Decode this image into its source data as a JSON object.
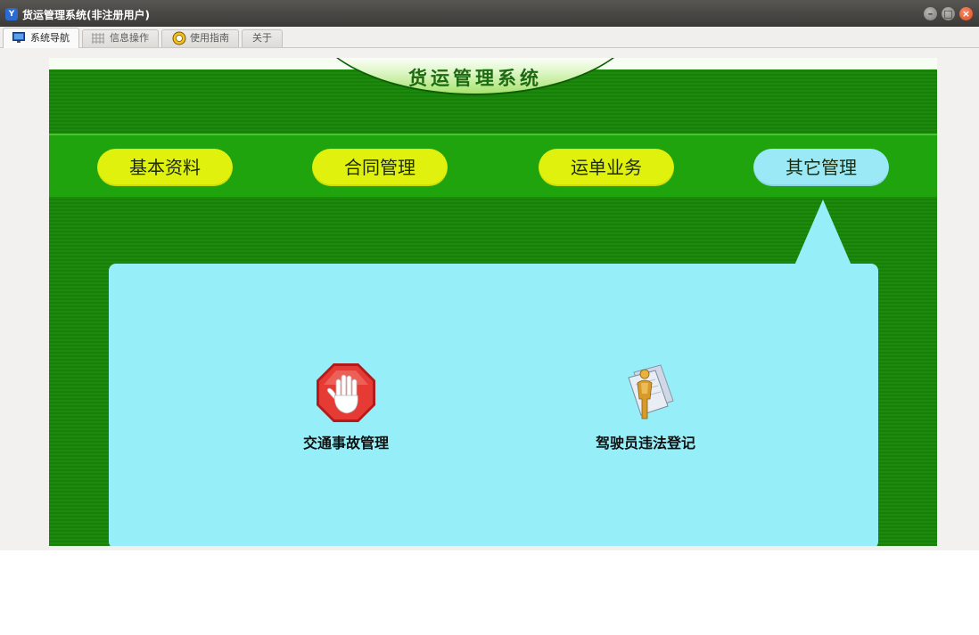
{
  "window": {
    "title": "货运管理系统(非注册用户)",
    "app_icon_glyph": "Y",
    "controls": [
      "minimize",
      "maximize",
      "close"
    ]
  },
  "tabs": [
    {
      "label": "系统导航",
      "icon": "monitor-icon",
      "active": true
    },
    {
      "label": "信息操作",
      "icon": "grid-icon",
      "active": false
    },
    {
      "label": "使用指南",
      "icon": "lifebuoy-icon",
      "active": false
    },
    {
      "label": "关于",
      "icon": "",
      "active": false
    }
  ],
  "main": {
    "system_title": "货运管理系统",
    "nav": [
      {
        "label": "基本资料",
        "active": false
      },
      {
        "label": "合同管理",
        "active": false
      },
      {
        "label": "运单业务",
        "active": false
      },
      {
        "label": "其它管理",
        "active": true
      }
    ],
    "features": [
      {
        "label": "交通事故管理",
        "icon": "stop-hand-icon"
      },
      {
        "label": "驾驶员违法登记",
        "icon": "person-document-icon"
      }
    ]
  },
  "colors": {
    "panel_green": "#1d8a0b",
    "nav_band_green": "#1fa40e",
    "pill_yellow": "#dff10c",
    "pill_active_cyan": "#9be9f7",
    "content_cyan": "#96eff8",
    "title_green": "#1c6a12"
  }
}
